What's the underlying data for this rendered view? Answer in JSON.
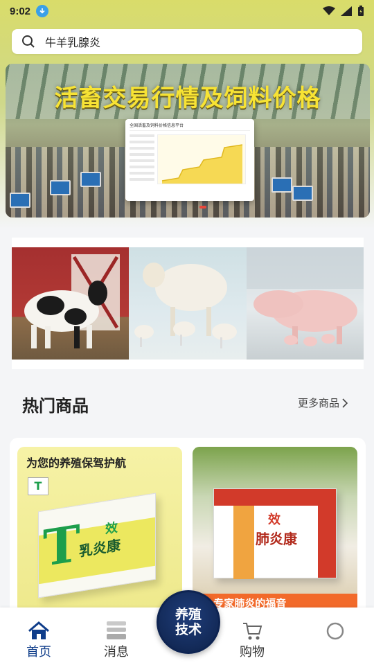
{
  "status_bar": {
    "time": "9:02"
  },
  "search": {
    "query": "牛羊乳腺炎"
  },
  "banner": {
    "title": "活畜交易行情及饲料价格",
    "card_header": "全国活畜及饲料价格信息平台"
  },
  "hot_section": {
    "title": "热门商品",
    "more_label": "更多商品"
  },
  "products": [
    {
      "slogan": "为您的养殖保驾护航",
      "name": "乳炎康",
      "badge": "效",
      "logo": "T"
    },
    {
      "name": "肺炎康",
      "badge": "效",
      "tagline": "荐 专家肺炎的福音"
    }
  ],
  "bottom_nav": {
    "home": "首页",
    "messages": "消息",
    "center_line1": "养殖",
    "center_line2": "技术",
    "cart": "购物"
  },
  "colors": {
    "accent": "#0f3d8a",
    "banner_title": "#f7e334",
    "promo_red": "#d23a2a"
  }
}
